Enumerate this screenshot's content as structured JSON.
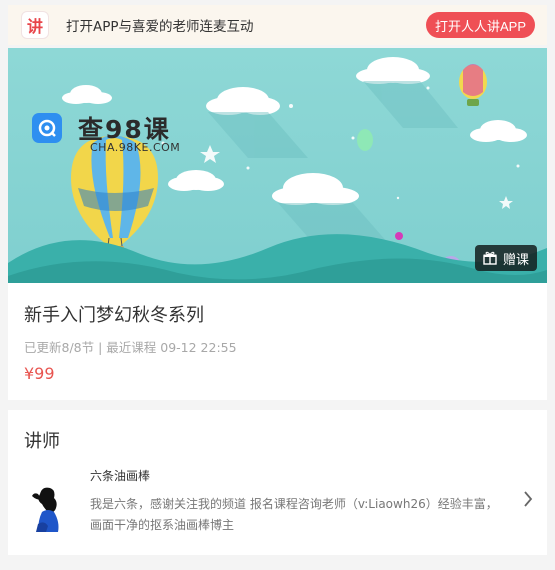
{
  "topbar": {
    "logo_char": "讲",
    "promo_text": "打开APP与喜爱的老师连麦互动",
    "open_button": "打开人人讲APP",
    "accent": "#ef4f55"
  },
  "banner": {
    "watermark_title": "查98课",
    "watermark_sub": "CHA.98KE.COM",
    "gift_label": "赠课"
  },
  "course": {
    "title": "新手入门梦幻秋冬系列",
    "meta": "已更新8/8节 | 最近课程 09-12 22:55",
    "price": "¥99"
  },
  "teacher_section": {
    "heading": "讲师",
    "name": "六条油画棒",
    "description": "我是六条，感谢关注我的频道 报名课程咨询老师（v:Liaowh26）经验丰富，画面干净的抠系油画棒博主"
  }
}
